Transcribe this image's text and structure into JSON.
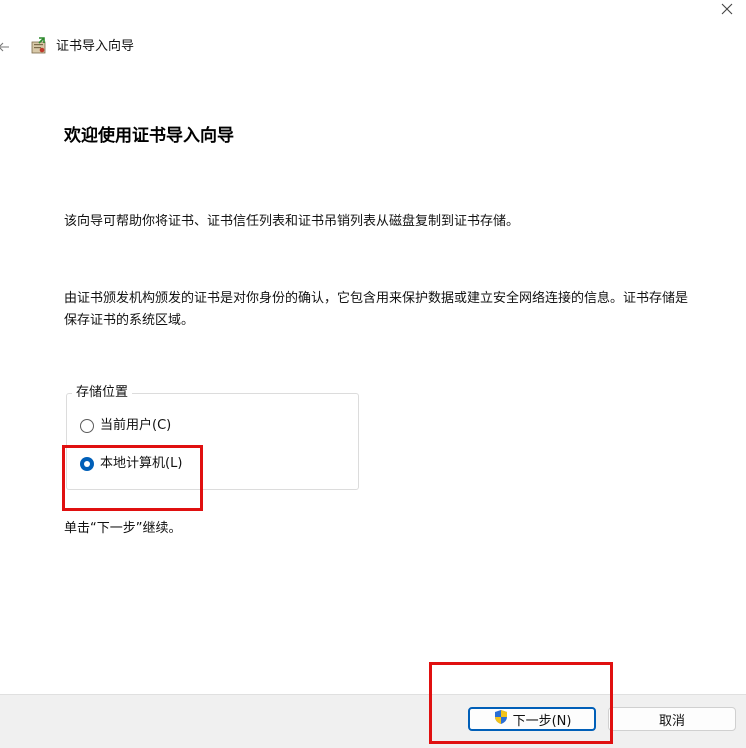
{
  "window": {
    "title": "证书导入向导"
  },
  "icons": {
    "close": "close-icon",
    "back": "back-arrow-icon",
    "wizard": "certificate-wizard-icon",
    "shield": "uac-shield-icon"
  },
  "content": {
    "heading": "欢迎使用证书导入向导",
    "paragraph1": "该向导可帮助你将证书、证书信任列表和证书吊销列表从磁盘复制到证书存储。",
    "paragraph2": "由证书颁发机构颁发的证书是对你身份的确认，它包含用来保护数据或建立安全网络连接的信息。证书存储是保存证书的系统区域。",
    "hint": "单击“下一步”继续。"
  },
  "store_location": {
    "label": "存储位置",
    "options": [
      {
        "label": "当前用户(C)",
        "checked": false
      },
      {
        "label": "本地计算机(L)",
        "checked": true
      }
    ]
  },
  "buttons": {
    "next": "下一步(N)",
    "cancel": "取消"
  },
  "colors": {
    "accent": "#005fb8",
    "highlight": "#e01010",
    "footer_bg": "#f0f0f0"
  }
}
